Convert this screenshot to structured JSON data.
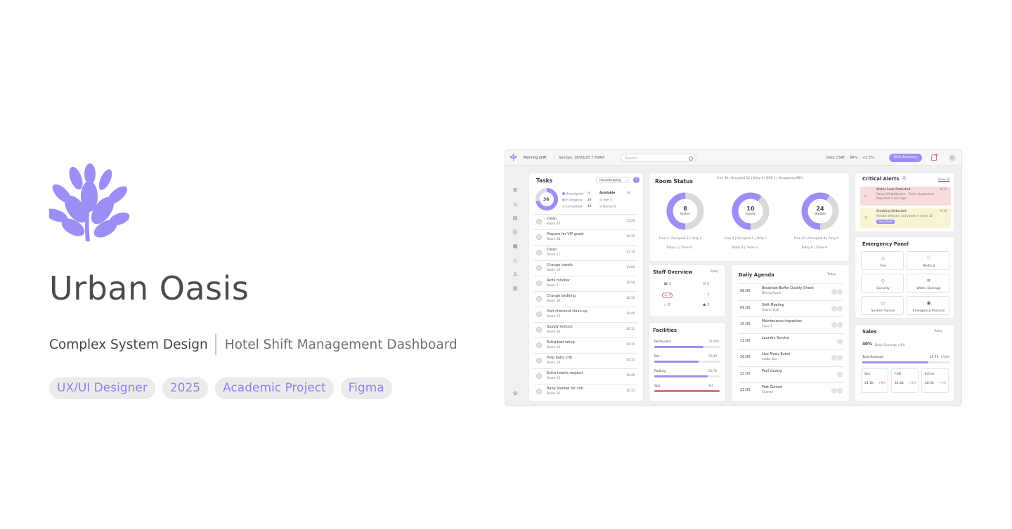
{
  "brand": {
    "title": "Urban Oasis",
    "subtitle_a": "Complex System Design",
    "subtitle_b": "Hotel Shift Management Dashboard",
    "accent": "#9b8ff5",
    "tags": [
      "UX/UI Designer",
      "2025",
      "Academic Project",
      "Figma"
    ]
  },
  "dashboard": {
    "topbar": {
      "greeting": "Morning shift",
      "date": "Sunday, 16/03/25 7:30AM",
      "search_placeholder": "Search",
      "csat_label": "Daily CSAT",
      "csat_value": "84%",
      "csat_delta": "+3.5%",
      "summary_button": "Shift Summary",
      "avatar": "JD"
    },
    "tasks": {
      "title": "Tasks",
      "filter": "Housekeeping",
      "badge": "1",
      "total": "36",
      "legend": [
        {
          "label": "Unassigned",
          "value": "5"
        },
        {
          "label": "In Progress",
          "value": "20"
        },
        {
          "label": "Completed",
          "value": "10"
        }
      ],
      "available_label": "Available",
      "all_label": "All",
      "staff": [
        {
          "label": "Tom T."
        },
        {
          "label": "Danny B."
        }
      ],
      "items": [
        {
          "name": "Clean",
          "room": "Room 24",
          "time": "11:20"
        },
        {
          "name": "Prepare for VIP guest",
          "room": "Room 38",
          "time": "10:15"
        },
        {
          "name": "Clean",
          "room": "Room 11",
          "time": "11:10"
        },
        {
          "name": "Change towels",
          "room": "Room 16",
          "time": "11:00"
        },
        {
          "name": "Refill minibar",
          "room": "Room 1",
          "time": "10:50"
        },
        {
          "name": "Change bedding",
          "room": "Room 20",
          "time": "10:11"
        },
        {
          "name": "Post checkout clean-up",
          "room": "Room 15",
          "time": "10:40"
        },
        {
          "name": "Supply restock",
          "room": "Room 26",
          "time": "10:11"
        },
        {
          "name": "Extra bed setup",
          "room": "Room 24",
          "time": "10:15"
        },
        {
          "name": "Prep baby crib",
          "room": "Room 16",
          "time": "10:11"
        },
        {
          "name": "Extra towels request",
          "room": "Room 15",
          "time": "10:40"
        },
        {
          "name": "Baby blanket for crib",
          "room": "Room 16",
          "time": "10:11"
        }
      ]
    },
    "room_status": {
      "title": "Room Status",
      "legend": "Free 36 | Occupied 12 | Dirty 4 | OOS 1 | Occupancy 88%",
      "rings": [
        {
          "value": "8",
          "label": "Suites",
          "sub": "Free 4 | Occupied 2 | Dirty 2",
          "foot": "Today 3 | Tmrw 0"
        },
        {
          "value": "10",
          "label": "Family",
          "sub": "Free 4 | Occupied 5 | Dirty 1",
          "foot": "Today 4 | Tmrw 3"
        },
        {
          "value": "24",
          "label": "Double",
          "sub": "Free 10 | Occupied 8 | Dirty 6",
          "foot": "Today 8 | Tmrw 6"
        }
      ]
    },
    "staff": {
      "title": "Staff Overview",
      "filter": "Today",
      "stats": [
        "2",
        "5",
        "4",
        "2",
        "6",
        "3"
      ]
    },
    "facilities": {
      "title": "Facilities",
      "items": [
        {
          "name": "Restaurant",
          "value": "75/100",
          "fill": 0.75,
          "color": "#9b8ff5"
        },
        {
          "name": "Bar",
          "value": "32/40",
          "fill": 0.68,
          "color": "#9b8ff5"
        },
        {
          "name": "Parking",
          "value": "65/78",
          "fill": 0.82,
          "color": "#9b8ff5"
        },
        {
          "name": "Spa",
          "value": "4/4",
          "fill": 1.0,
          "color": "#e26f7d"
        }
      ]
    },
    "agenda": {
      "title": "Daily Agenda",
      "filter": "Today",
      "items": [
        {
          "time": "08:00",
          "title": "Breakfast Buffet Quality Check",
          "sub": "Dining Room"
        },
        {
          "time": "09:00",
          "title": "Shift Meeting",
          "sub": "Adams Hall"
        },
        {
          "time": "10:00",
          "title": "Maintenance inspection",
          "sub": "Floor 3"
        },
        {
          "time": "13:00",
          "title": "Laundry Service",
          "sub": ""
        },
        {
          "time": "20:00",
          "title": "Live Music Event",
          "sub": "Lobby Bar"
        },
        {
          "time": "22:00",
          "title": "Pool closing",
          "sub": ""
        },
        {
          "time": "23:00",
          "title": "Pest Control",
          "sub": "Kitchen"
        }
      ]
    },
    "alerts": {
      "title": "Critical Alerts",
      "count": "2",
      "view_all": "View all",
      "items": [
        {
          "title": "Water Leak Detected",
          "body": "Room 14 bathroom - Team dispatched",
          "meta": "Reported 2 min ago",
          "time": "8:15",
          "bg": "#f8dcdc"
        },
        {
          "title": "Smoking Detected",
          "body": "Smoke detector activated in room 32",
          "meta": "",
          "time": "9:15",
          "bg": "#f8f5d6",
          "button": "Send Staff"
        }
      ]
    },
    "emergency": {
      "title": "Emergency Panel",
      "buttons": [
        {
          "label": "Fire",
          "icon": "fire-icon"
        },
        {
          "label": "Medical",
          "icon": "medical-icon"
        },
        {
          "label": "Security",
          "icon": "shield-icon"
        },
        {
          "label": "Water Damage",
          "icon": "water-icon"
        },
        {
          "label": "System Failure",
          "icon": "monitor-icon"
        },
        {
          "label": "Emergency Protocol",
          "icon": "alarm-icon"
        }
      ]
    },
    "sales": {
      "title": "Sales",
      "filter": "Today",
      "headline": "40%",
      "headline_label": "Daily Earnings",
      "headline_delta": "+4%",
      "total_label": "Total Revenue",
      "total_value": "$3.7k",
      "total_delta": "+18%",
      "total_fill": 0.75,
      "cols": [
        {
          "name": "Spa",
          "value": "$1.2k",
          "delta": "+8%"
        },
        {
          "name": "F&B",
          "value": "$1.0k",
          "delta": "+5%"
        },
        {
          "name": "Extras",
          "value": "$0.5k",
          "delta": "+3%"
        }
      ]
    }
  }
}
